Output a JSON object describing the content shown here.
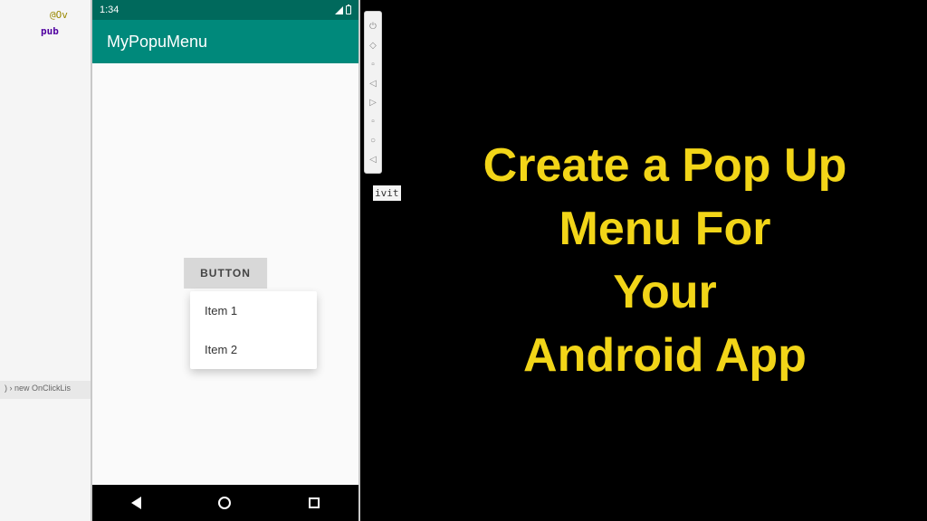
{
  "code": {
    "annotation": "@Ov",
    "modifier": "pub",
    "fragment": "ivit",
    "breadcrumb": ") › new OnClickLis"
  },
  "status": {
    "time": "1:34"
  },
  "app": {
    "title": "MyPopuMenu",
    "button_label": "BUTTON",
    "popup": {
      "items": [
        "Item 1",
        "Item 2"
      ]
    }
  },
  "slide": {
    "line1": "Create a Pop Up",
    "line2": "Menu For",
    "line3": "Your",
    "line4": "Android App"
  }
}
